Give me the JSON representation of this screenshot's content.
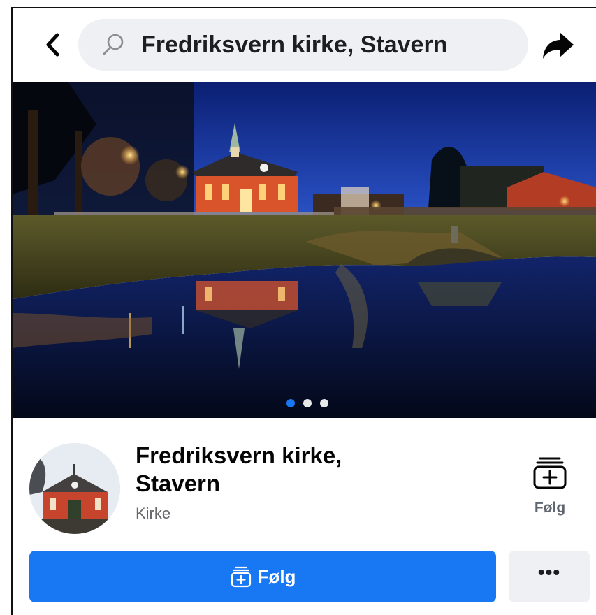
{
  "search": {
    "query": "Fredriksvern kirke, Stavern"
  },
  "cover": {
    "slide_count": 3,
    "active_slide": 1
  },
  "page": {
    "name": "Fredriksvern kirke, Stavern",
    "category": "Kirke"
  },
  "actions": {
    "follow_side_label": "Følg",
    "follow_label": "Følg",
    "more_label": "•••"
  },
  "colors": {
    "accent": "#1877f2",
    "search_bg": "#eef0f3",
    "secondary_text": "#65676b"
  },
  "icons": {
    "back": "chevron-left-icon",
    "search": "search-icon",
    "share": "share-arrow-icon",
    "follow": "follow-plus-icon"
  }
}
